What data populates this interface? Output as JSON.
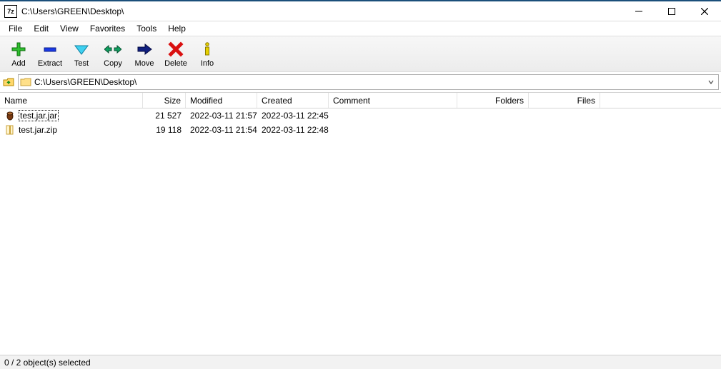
{
  "window": {
    "title": "C:\\Users\\GREEN\\Desktop\\",
    "app_icon_label": "7z"
  },
  "menu": {
    "file": "File",
    "edit": "Edit",
    "view": "View",
    "favorites": "Favorites",
    "tools": "Tools",
    "help": "Help"
  },
  "toolbar": {
    "add": "Add",
    "extract": "Extract",
    "test": "Test",
    "copy": "Copy",
    "move": "Move",
    "delete": "Delete",
    "info": "Info"
  },
  "address": {
    "path": "C:\\Users\\GREEN\\Desktop\\"
  },
  "columns": {
    "name": "Name",
    "size": "Size",
    "modified": "Modified",
    "created": "Created",
    "comment": "Comment",
    "folders": "Folders",
    "files": "Files"
  },
  "rows": [
    {
      "icon": "jar-icon",
      "name": "test.jar.jar",
      "selected": true,
      "size": "21 527",
      "modified": "2022-03-11 21:57",
      "created": "2022-03-11 22:45",
      "comment": "",
      "folders": "",
      "files": ""
    },
    {
      "icon": "zip-icon",
      "name": "test.jar.zip",
      "selected": false,
      "size": "19 118",
      "modified": "2022-03-11 21:54",
      "created": "2022-03-11 22:48",
      "comment": "",
      "folders": "",
      "files": ""
    }
  ],
  "status": {
    "text": "0 / 2 object(s) selected"
  }
}
